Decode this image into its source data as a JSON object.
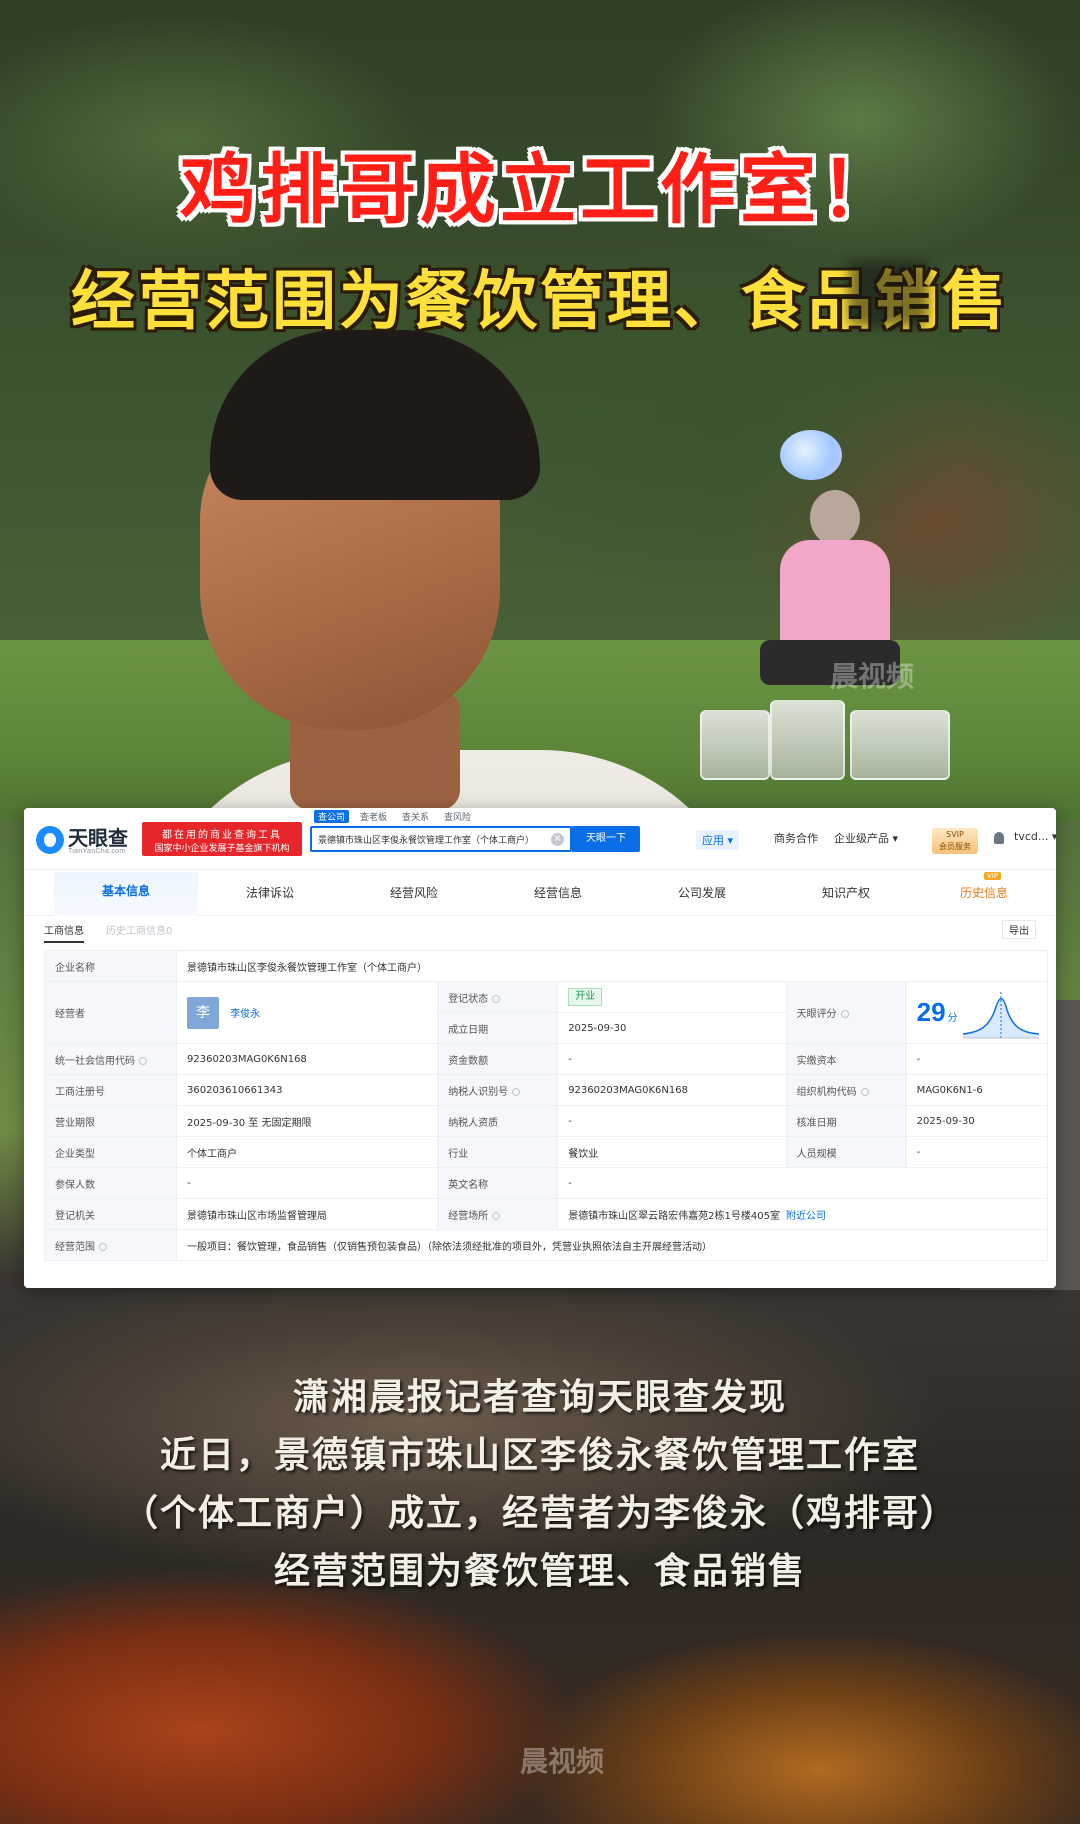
{
  "headline": "鸡排哥成立工作室！",
  "subheadline": "经营范围为餐饮管理、食品销售",
  "site": {
    "logo_name": "天眼查",
    "logo_sub": "TianYanCha.com",
    "promo_line1": "都在用的商业查询工具",
    "promo_line2": "国家中小企业发展子基金旗下机构",
    "search_tabs": [
      "查公司",
      "查老板",
      "查关系",
      "查风险"
    ],
    "search_value": "景德镇市珠山区李俊永餐饮管理工作室（个体工商户）",
    "search_button": "天眼一下",
    "nav": {
      "apps": "应用 ▾",
      "business": "商务合作",
      "products": "企业级产品 ▾",
      "svip_line1": "SVIP",
      "svip_line2": "会员服务",
      "user": "tvcd... ▾"
    }
  },
  "tabs": [
    "基本信息",
    "法律诉讼",
    "经营风险",
    "经营信息",
    "公司发展",
    "知识产权",
    "历史信息"
  ],
  "vip_tag": "VIP",
  "subtabs": {
    "active": "工商信息",
    "inactive": "历史工商信息0",
    "export": "导出"
  },
  "company": {
    "name_label": "企业名称",
    "name": "景德镇市珠山区李俊永餐饮管理工作室（个体工商户）",
    "operator_label": "经营者",
    "operator_avatar": "李",
    "operator_name": "李俊永",
    "status_label": "登记状态",
    "status": "开业",
    "founded_label": "成立日期",
    "founded": "2025-09-30",
    "score_label": "天眼评分",
    "score": "29",
    "score_unit": "分",
    "credit_code_label": "统一社会信用代码",
    "credit_code": "92360203MAG0K6N168",
    "capital_label": "资金数额",
    "capital": "-",
    "paid_capital_label": "实缴资本",
    "paid_capital": "-",
    "reg_no_label": "工商注册号",
    "reg_no": "360203610661343",
    "tax_id_label": "纳税人识别号",
    "tax_id": "92360203MAG0K6N168",
    "org_code_label": "组织机构代码",
    "org_code": "MAG0K6N1-6",
    "term_label": "营业期限",
    "term": "2025-09-30 至 无固定期限",
    "tax_qual_label": "纳税人资质",
    "tax_qual": "-",
    "approval_label": "核准日期",
    "approval": "2025-09-30",
    "type_label": "企业类型",
    "type": "个体工商户",
    "industry_label": "行业",
    "industry": "餐饮业",
    "staff_label": "人员规模",
    "staff": "-",
    "insured_label": "参保人数",
    "insured": "-",
    "english_label": "英文名称",
    "english": "-",
    "authority_label": "登记机关",
    "authority": "景德镇市珠山区市场监督管理局",
    "address_label": "经营场所",
    "address": "景德镇市珠山区翠云路宏伟嘉苑2栋1号楼405室",
    "nearby": "附近公司",
    "scope_label": "经营范围",
    "scope": "一般项目：餐饮管理，食品销售（仅销售预包装食品）（除依法须经批准的项目外，凭营业执照依法自主开展经营活动）"
  },
  "caption": {
    "line1": "潇湘晨报记者查询天眼查发现",
    "line2": "近日，景德镇市珠山区李俊永餐饮管理工作室",
    "line3": "（个体工商户）成立，经营者为李俊永（鸡排哥）",
    "line4": "经营范围为餐饮管理、食品销售"
  },
  "watermark": "晨视频",
  "colors": {
    "headline": "#ff1f17",
    "subheadline": "#ffe03a",
    "brand_blue": "#0a6ee6",
    "promo_red": "#e6262a"
  }
}
